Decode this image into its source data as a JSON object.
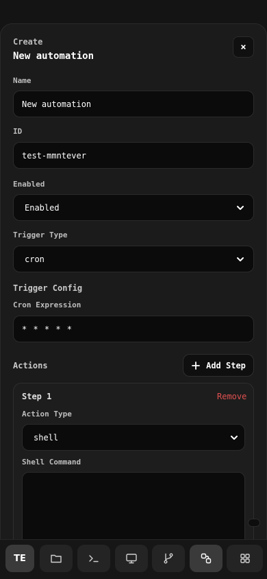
{
  "header": {
    "kicker": "Create",
    "title": "New automation",
    "close_label": "×"
  },
  "form": {
    "name_label": "Name",
    "name_value": "New automation",
    "id_label": "ID",
    "id_value": "test-mmntever",
    "enabled_label": "Enabled",
    "enabled_value": "Enabled",
    "trigger_type_label": "Trigger Type",
    "trigger_type_value": "cron",
    "trigger_config_title": "Trigger Config",
    "cron_label": "Cron Expression",
    "cron_value": "* * * * *"
  },
  "actions": {
    "title": "Actions",
    "add_step_label": "Add Step",
    "steps": [
      {
        "title": "Step 1",
        "remove_label": "Remove",
        "action_type_label": "Action Type",
        "action_type_value": "shell",
        "shell_command_label": "Shell Command",
        "shell_command_value": ""
      }
    ]
  },
  "dock": {
    "items": [
      {
        "label": "TE",
        "icon": "workspace-avatar",
        "active": true
      },
      {
        "icon": "folder-icon"
      },
      {
        "icon": "terminal-icon"
      },
      {
        "icon": "monitor-icon"
      },
      {
        "icon": "git-branch-icon"
      },
      {
        "icon": "workflow-icon",
        "active": true
      },
      {
        "icon": "grid-icon"
      }
    ]
  },
  "colors": {
    "accent_danger": "#e05050",
    "background": "#141414",
    "surface": "#1b1b1b",
    "field": "#0b0b0b"
  }
}
